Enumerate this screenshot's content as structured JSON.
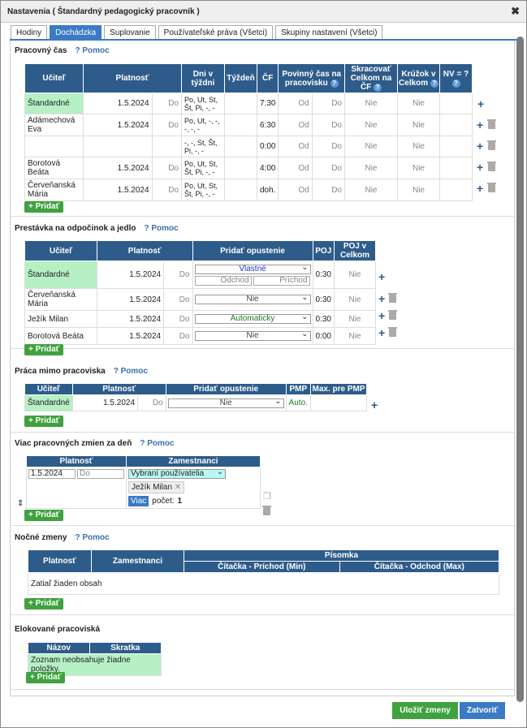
{
  "dialog": {
    "title": "Nastavenia ( Štandardný pedagogický pracovník )"
  },
  "tabs": [
    "Hodiny",
    "Dochádzka",
    "Suplovanie",
    "Používateľské práva (Všetci)",
    "Skupiny nastavení (Všetci)"
  ],
  "pracovny": {
    "title": "Pracovný čas",
    "help": "Pomoc",
    "add": "+ Pridať",
    "headers": {
      "ucitel": "Učiteľ",
      "platnost": "Platnosť",
      "dni": "Dni v týždni",
      "tyzden": "Týždeň",
      "cf": "ČF",
      "povinny": "Povinný čas na pracovisku",
      "skracovat": "Skracovať Celkom na ČF",
      "kruzok": "Krúžok v Celkom",
      "nv": "NV = ?"
    },
    "rows": [
      {
        "name": "Štandardné",
        "date": "1.5.2024",
        "do": "Do",
        "days": "Po, Ut, St, Št, Pi, -, -",
        "cf": "7:30",
        "od": "Od",
        "do2": "Do",
        "sk": "Nie",
        "kr": "Nie"
      },
      {
        "name": "Adámechová Eva",
        "date": "1.5.2024",
        "do": "Do",
        "days": "Po, Ut, -, -, -, -, -",
        "cf": "6:30",
        "od": "Od",
        "do2": "Do",
        "sk": "Nie",
        "kr": "Nie"
      },
      {
        "name": "",
        "date": "",
        "do": "",
        "days": "-, -, St, Št, Pi, -, -",
        "cf": "0:00",
        "od": "Od",
        "do2": "Do",
        "sk": "Nie",
        "kr": "Nie"
      },
      {
        "name": "Borotová Beáta",
        "date": "1.5.2024",
        "do": "Do",
        "days": "Po, Ut, St, Št, Pi, -, -",
        "cf": "4:00",
        "od": "Od",
        "do2": "Do",
        "sk": "Nie",
        "kr": "Nie"
      },
      {
        "name": "Červeňanská Mária",
        "date": "1.5.2024",
        "do": "Do",
        "days": "Po, Ut, St, Št, Pi, -, -",
        "cf": "doh.",
        "od": "Od",
        "do2": "Do",
        "sk": "Nie",
        "kr": "Nie"
      }
    ]
  },
  "prestavka": {
    "title": "Prestávka na odpočinok a jedlo",
    "help": "Pomoc",
    "add": "+ Pridať",
    "headers": {
      "ucitel": "Učiteľ",
      "platnost": "Platnosť",
      "pridat": "Pridať opustenie",
      "poj": "POJ",
      "pojc": "POJ v Celkom"
    },
    "rows": [
      {
        "name": "Štandardné",
        "date": "1.5.2024",
        "do": "Do",
        "sel": "Vlastné",
        "odchod": "Odchod",
        "prichod": "Príchod",
        "poj": "0:30",
        "pojc": "Nie"
      },
      {
        "name": "Červeňanská Mária",
        "date": "1.5.2024",
        "do": "Do",
        "sel": "Nie",
        "poj": "0:30",
        "pojc": "Nie"
      },
      {
        "name": "Ježík Milan",
        "date": "1.5.2024",
        "do": "Do",
        "sel": "Automaticky",
        "poj": "0:30",
        "pojc": "Nie"
      },
      {
        "name": "Borotová Beáta",
        "date": "1.5.2024",
        "do": "Do",
        "sel": "Nie",
        "poj": "0:00",
        "pojc": "Nie"
      }
    ]
  },
  "praca": {
    "title": "Práca mimo pracoviska",
    "help": "Pomoc",
    "add": "+ Pridať",
    "headers": {
      "ucitel": "Učiteľ",
      "platnost": "Platnosť",
      "pridat": "Pridať opustenie",
      "pmp": "PMP",
      "max": "Max. pre PMP"
    },
    "row": {
      "name": "Štandardné",
      "date": "1.5.2024",
      "do": "Do",
      "sel": "Nie",
      "pmp": "Auto."
    }
  },
  "viac": {
    "title": "Viac pracovných zmien za deň",
    "help": "Pomoc",
    "add": "+ Pridať",
    "headers": {
      "platnost": "Platnosť",
      "zam": "Zamestnanci"
    },
    "date": "1.5.2024",
    "do": "Do",
    "sel": "Vybraní používatelia",
    "chip": "Ježík Milan",
    "viac": "Viac",
    "pocet": "počet:",
    "count": "1"
  },
  "nocne": {
    "title": "Nočné zmeny",
    "help": "Pomoc",
    "add": "+ Pridať",
    "headers": {
      "platnost": "Platnosť",
      "zam": "Zamestnanci",
      "pisomka": "Písomka",
      "prichod": "Čítačka - Príchod (Min)",
      "odchod": "Čítačka - Odchod (Max)"
    },
    "empty": "Zatiaľ žiaden obsah"
  },
  "elok": {
    "title": "Elokované pracoviská",
    "add": "+ Pridať",
    "headers": {
      "nazov": "Názov",
      "skratka": "Skratka"
    },
    "empty": "Zoznam neobsahuje žiadne položky."
  },
  "footer": {
    "save": "Uložiť zmeny",
    "close": "Zatvoriť"
  }
}
